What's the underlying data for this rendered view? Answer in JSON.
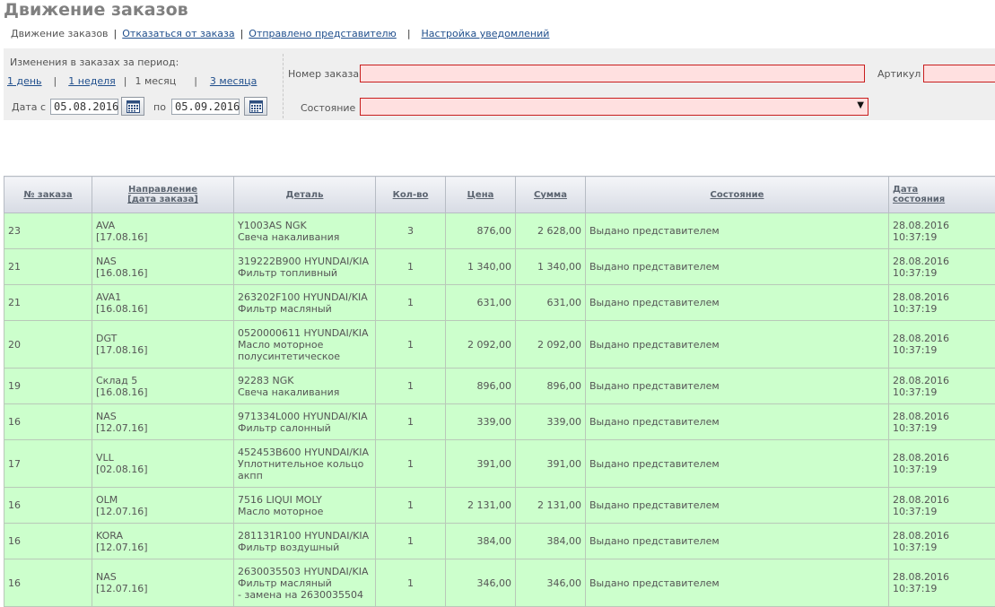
{
  "page": {
    "title": "Движение заказов"
  },
  "tabs": [
    {
      "label": "Движение заказов",
      "active": true
    },
    {
      "label": "Отказаться от заказа",
      "active": false
    },
    {
      "label": "Отправлено представителю",
      "active": false
    },
    {
      "label": "Настройка уведомлений",
      "active": false
    }
  ],
  "filters": {
    "period_label": "Изменения в заказах за период:",
    "periods": [
      "1 день",
      "1 неделя",
      "1 месяц",
      "3 месяца"
    ],
    "active_period": "1 месяц",
    "date_from_label": "Дата с",
    "date_from": "05.08.2016",
    "date_to_label": "по",
    "date_to": "05.09.2016",
    "order_number_label": "Номер заказа",
    "order_number_value": "",
    "article_label": "Артикул",
    "article_value": "",
    "status_label": "Состояние",
    "status_value": ""
  },
  "table": {
    "headers": {
      "order_no": "№ заказа",
      "direction_line1": "Направление",
      "direction_line2": "[дата заказа]",
      "part": "Деталь",
      "qty": "Кол-во",
      "price": "Цена",
      "sum": "Сумма",
      "status": "Состояние",
      "status_date_line1": "Дата",
      "status_date_line2": "состояния"
    },
    "rows": [
      {
        "order_no": "23",
        "direction": "AVA",
        "order_date": "[17.08.16]",
        "part_lines": [
          "Y1003AS NGK",
          "Свеча накаливания"
        ],
        "qty": "3",
        "price": "876,00",
        "sum": "2 628,00",
        "status": "Выдано представителем",
        "status_date": "28.08.2016",
        "status_time": "10:37:19"
      },
      {
        "order_no": "21",
        "direction": "NAS",
        "order_date": "[16.08.16]",
        "part_lines": [
          "319222B900 HYUNDAI/KIA",
          "Фильтр топливный"
        ],
        "qty": "1",
        "price": "1 340,00",
        "sum": "1 340,00",
        "status": "Выдано представителем",
        "status_date": "28.08.2016",
        "status_time": "10:37:19"
      },
      {
        "order_no": "21",
        "direction": "AVA1",
        "order_date": "[16.08.16]",
        "part_lines": [
          "263202F100 HYUNDAI/KIA",
          "Фильтр масляный"
        ],
        "qty": "1",
        "price": "631,00",
        "sum": "631,00",
        "status": "Выдано представителем",
        "status_date": "28.08.2016",
        "status_time": "10:37:19"
      },
      {
        "order_no": "20",
        "direction": "DGT",
        "order_date": "[17.08.16]",
        "part_lines": [
          "0520000611 HYUNDAI/KIA",
          "Масло моторное",
          "полусинтетическое"
        ],
        "qty": "1",
        "price": "2 092,00",
        "sum": "2 092,00",
        "status": "Выдано представителем",
        "status_date": "28.08.2016",
        "status_time": "10:37:19"
      },
      {
        "order_no": "19",
        "direction": "Склад 5",
        "order_date": "[16.08.16]",
        "part_lines": [
          "92283 NGK",
          "Свеча накаливания"
        ],
        "qty": "1",
        "price": "896,00",
        "sum": "896,00",
        "status": "Выдано представителем",
        "status_date": "28.08.2016",
        "status_time": "10:37:19"
      },
      {
        "order_no": "16",
        "direction": "NAS",
        "order_date": "[12.07.16]",
        "part_lines": [
          "971334L000 HYUNDAI/KIA",
          "Фильтр салонный"
        ],
        "qty": "1",
        "price": "339,00",
        "sum": "339,00",
        "status": "Выдано представителем",
        "status_date": "28.08.2016",
        "status_time": "10:37:19"
      },
      {
        "order_no": "17",
        "direction": "VLL",
        "order_date": "[02.08.16]",
        "part_lines": [
          "452453B600 HYUNDAI/KIA",
          "Уплотнительное кольцо",
          "акпп"
        ],
        "qty": "1",
        "price": "391,00",
        "sum": "391,00",
        "status": "Выдано представителем",
        "status_date": "28.08.2016",
        "status_time": "10:37:19"
      },
      {
        "order_no": "16",
        "direction": "OLM",
        "order_date": "[12.07.16]",
        "part_lines": [
          "7516 LIQUI MOLY",
          "Масло моторное"
        ],
        "qty": "1",
        "price": "2 131,00",
        "sum": "2 131,00",
        "status": "Выдано представителем",
        "status_date": "28.08.2016",
        "status_time": "10:37:19"
      },
      {
        "order_no": "16",
        "direction": "KORA",
        "order_date": "[12.07.16]",
        "part_lines": [
          "281131R100 HYUNDAI/KIA",
          "Фильтр воздушный"
        ],
        "qty": "1",
        "price": "384,00",
        "sum": "384,00",
        "status": "Выдано представителем",
        "status_date": "28.08.2016",
        "status_time": "10:37:19"
      },
      {
        "order_no": "16",
        "direction": "NAS",
        "order_date": "[12.07.16]",
        "part_lines": [
          "2630035503 HYUNDAI/KIA",
          "Фильтр масляный",
          "- замена на 2630035504"
        ],
        "qty": "1",
        "price": "346,00",
        "sum": "346,00",
        "status": "Выдано представителем",
        "status_date": "28.08.2016",
        "status_time": "10:37:19"
      }
    ]
  }
}
